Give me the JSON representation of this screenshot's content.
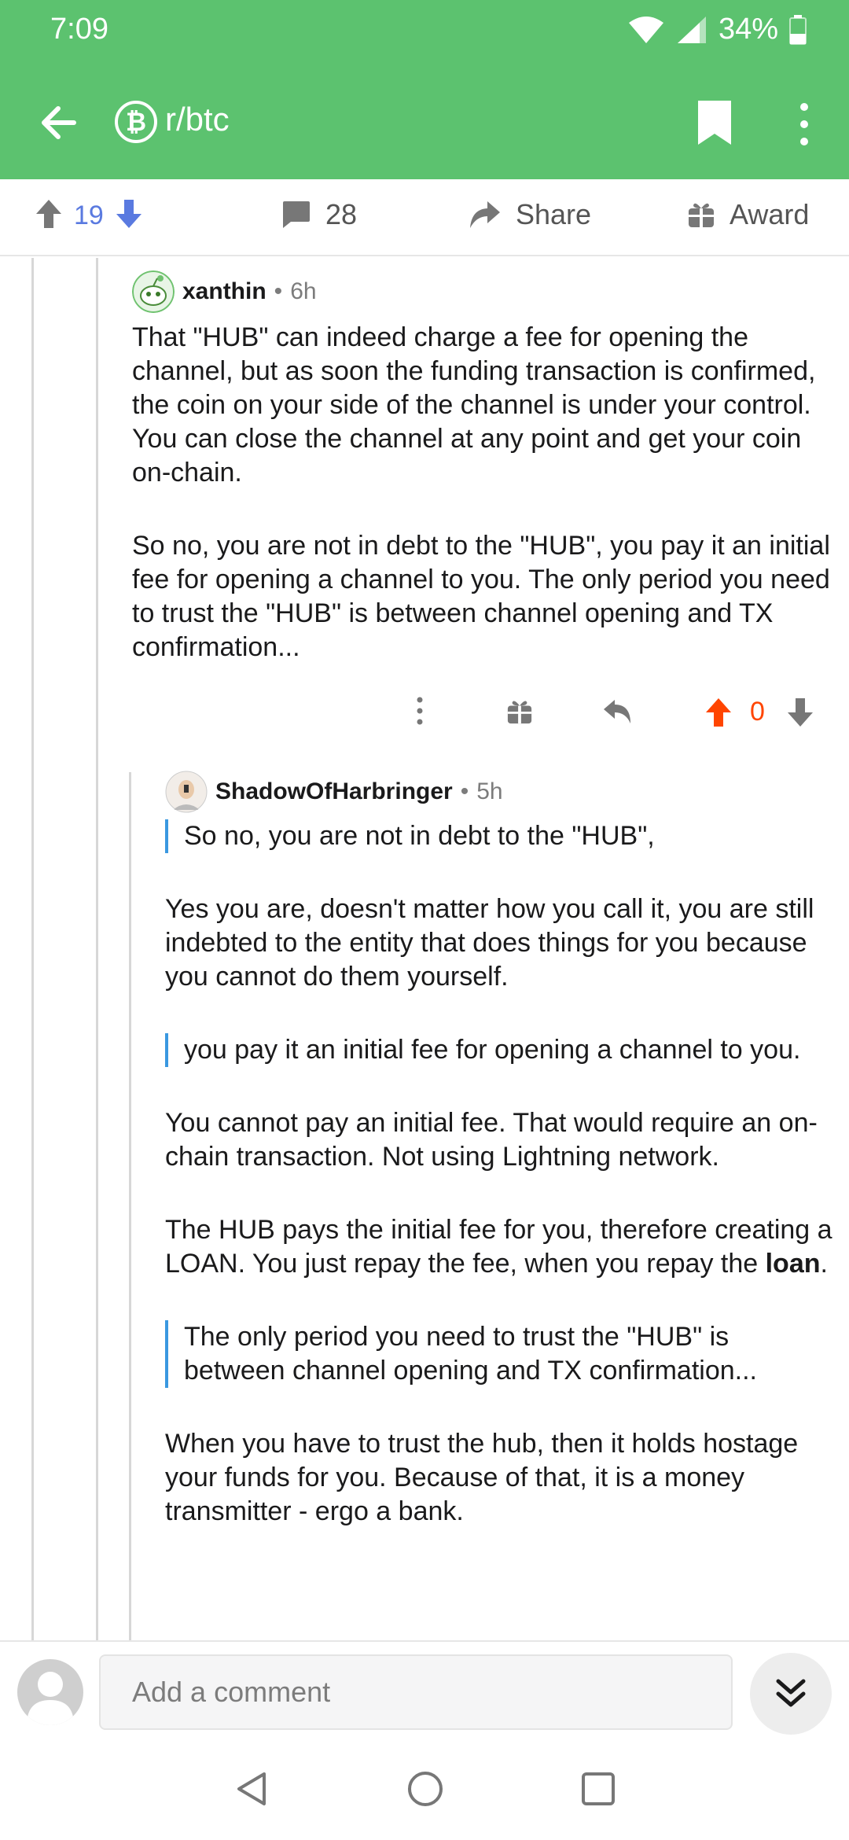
{
  "status_bar": {
    "time": "7:09",
    "battery": "34%"
  },
  "header": {
    "subreddit": "r/btc",
    "subreddit_icon": "bitcoin-icon",
    "accent": "#5cc26f"
  },
  "post_actions": {
    "score": "19",
    "comments": "28",
    "share": "Share",
    "award": "Award"
  },
  "comment1": {
    "author": "xanthin",
    "time": "6h",
    "paragraphs": [
      "That \"HUB\" can indeed charge a fee for opening the channel, but as soon  the funding transaction is confirmed, the coin on your side of the channel is under your control. You can close the channel at any point and get your coin on-chain.",
      "So no, you are not in debt to the \"HUB\", you pay it an initial fee for opening a channel to you. The only period you need to trust the \"HUB\" is between channel opening and TX confirmation..."
    ],
    "score": "0",
    "upvote_color": "#ff4500"
  },
  "comment2": {
    "author": "ShadowOfHarbringer",
    "time": "5h",
    "quote1": "So no, you are not in debt to the \"HUB\",",
    "p1": "Yes you are, doesn't matter how you call it, you are still indebted to the entity that does things for you because you cannot do them yourself.",
    "quote2": "you pay it an initial fee for opening a channel to you.",
    "p2": "You cannot pay an initial fee. That would require an on-chain transaction. Not using Lightning network.",
    "p3_start": "The HUB pays the initial fee for you, therefore creating a LOAN. You just repay the fee, when you repay the ",
    "p3_bold": "loan",
    "p3_end": ".",
    "quote3": "The only period you need to trust the \"HUB\" is between channel opening and TX confirmation...",
    "p4": "When you have to trust the hub, then it holds hostage your funds for you. Because of that, it is a money transmitter - ergo a bank."
  },
  "composer": {
    "placeholder": "Add a comment"
  }
}
